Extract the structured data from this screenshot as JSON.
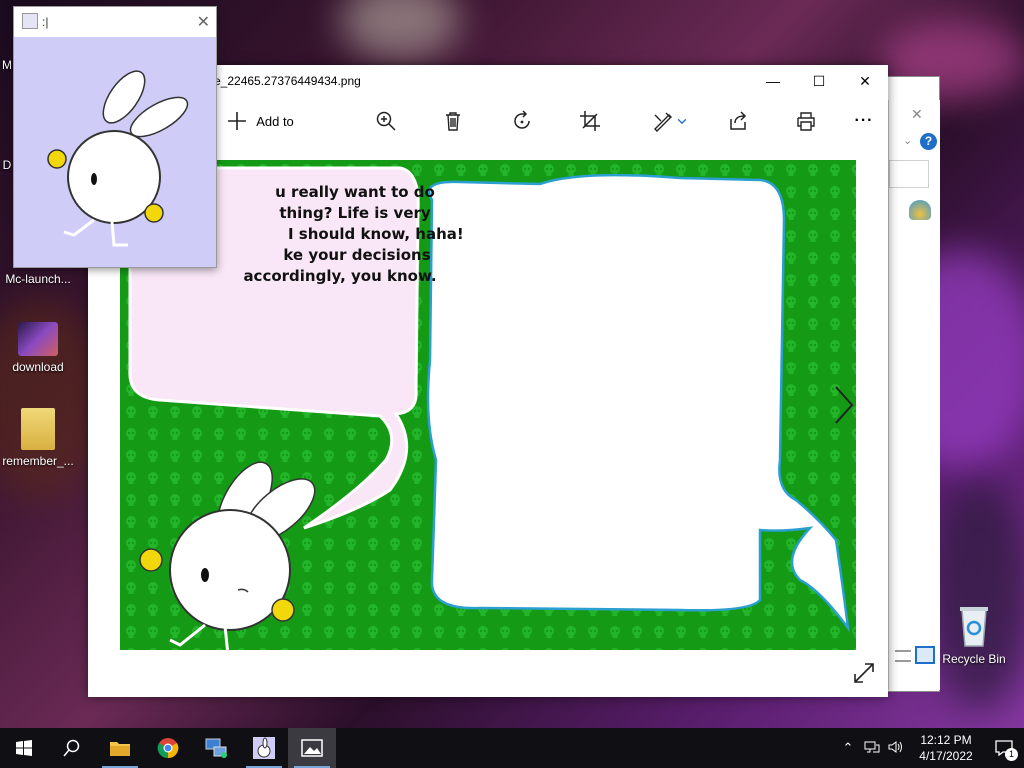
{
  "desktop": {
    "icons": [
      {
        "label": "M",
        "name": "desktop-icon-m"
      },
      {
        "label": "D",
        "name": "desktop-icon-d"
      },
      {
        "label": "Mc-launch...",
        "name": "desktop-icon-mc-launcher"
      },
      {
        "label": "download",
        "name": "desktop-icon-download"
      },
      {
        "label": "remember_...",
        "name": "desktop-icon-remember"
      },
      {
        "label": "Recycle Bin",
        "name": "desktop-icon-recycle-bin"
      }
    ]
  },
  "mini_window": {
    "title": ":|",
    "close": "✕"
  },
  "photos_window": {
    "title": "e_22465.27376449434.png",
    "controls": {
      "minimize": "—",
      "maximize": "☐",
      "close": "✕"
    },
    "toolbar": {
      "add_to": "Add to",
      "more": "···"
    },
    "comic": {
      "lines": [
        "u really want to do",
        "thing? Life is very",
        "I should know, haha!",
        "ke your decisions",
        "accordingly, you know."
      ]
    }
  },
  "taskbar": {
    "clock_time": "12:12 PM",
    "clock_date": "4/17/2022",
    "notification_count": "1"
  },
  "colors": {
    "comic_green": "#159a16",
    "speech_pink": "#f9e6f6",
    "mini_bg": "#cfccf7",
    "taskbar": "#101014"
  }
}
